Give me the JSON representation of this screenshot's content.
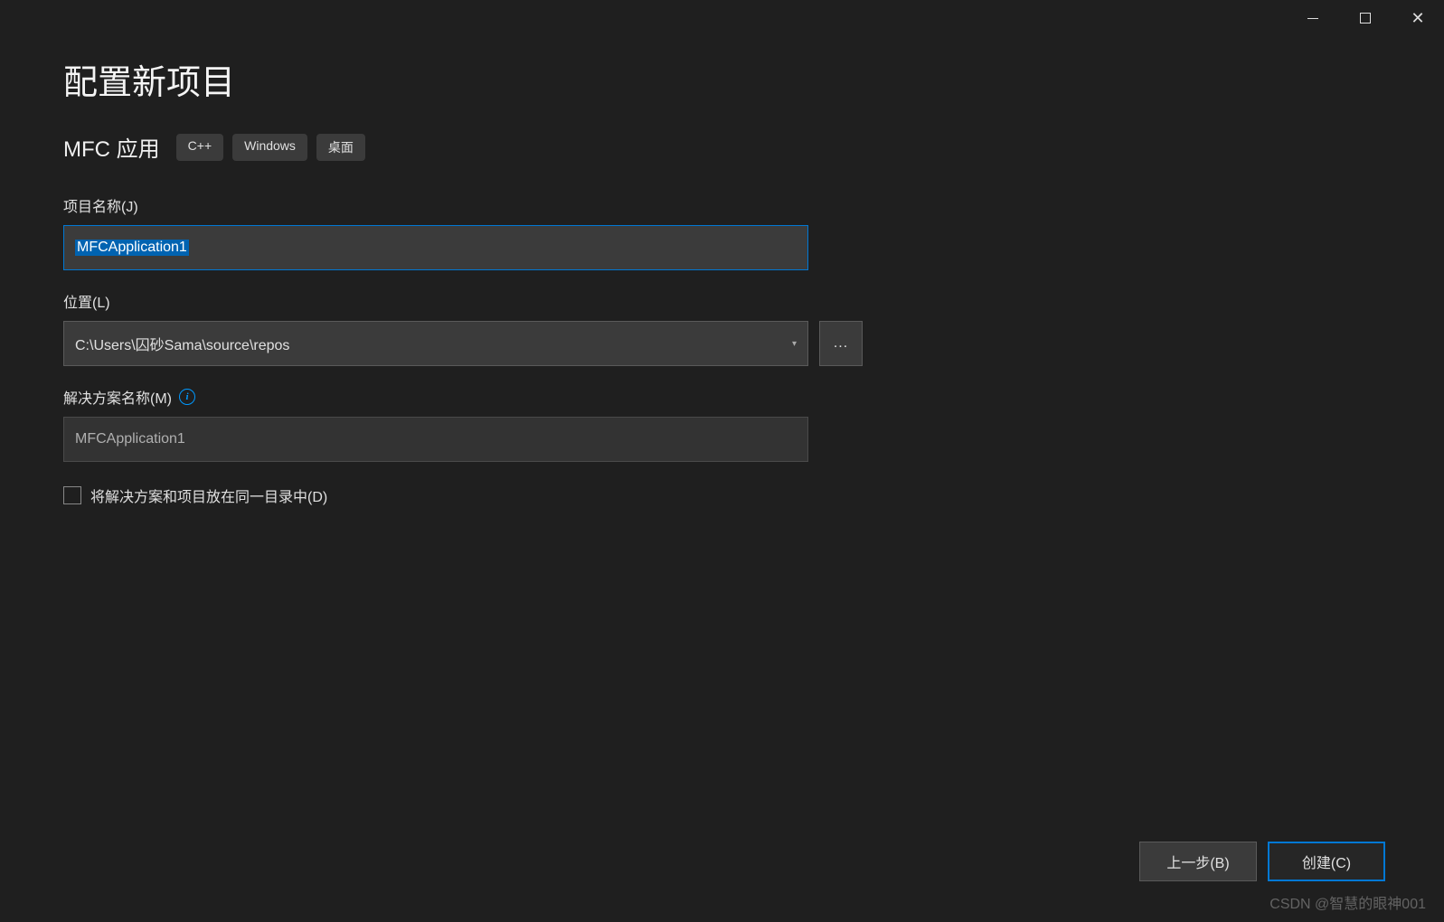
{
  "page": {
    "title": "配置新项目"
  },
  "project": {
    "type_label": "MFC 应用",
    "tags": [
      "C++",
      "Windows",
      "桌面"
    ]
  },
  "form": {
    "project_name": {
      "label": "项目名称(J)",
      "value": "MFCApplication1"
    },
    "location": {
      "label": "位置(L)",
      "value": "C:\\Users\\囚砂Sama\\source\\repos",
      "browse_label": "..."
    },
    "solution_name": {
      "label": "解决方案名称(M)",
      "value": "MFCApplication1"
    },
    "same_directory": {
      "label": "将解决方案和项目放在同一目录中(D)",
      "checked": false
    }
  },
  "buttons": {
    "back": "上一步(B)",
    "create": "创建(C)"
  },
  "watermark": "CSDN @智慧的眼神001"
}
